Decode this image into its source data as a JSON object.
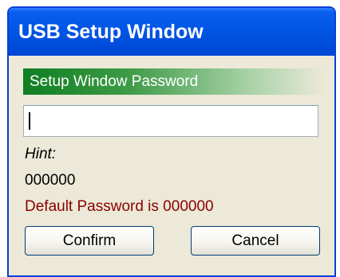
{
  "window": {
    "title": "USB Setup Window"
  },
  "section": {
    "header": "Setup Window Password"
  },
  "password_field": {
    "value": ""
  },
  "hint": {
    "label": "Hint:",
    "value": "000000",
    "default_password_text": "Default Password is 000000"
  },
  "buttons": {
    "confirm_label": "Confirm",
    "cancel_label": "Cancel"
  },
  "colors": {
    "titlebar": "#0055e5",
    "header_green": "#0f7e22",
    "default_password_text": "#8b0000",
    "client_background": "#ece9d8"
  }
}
